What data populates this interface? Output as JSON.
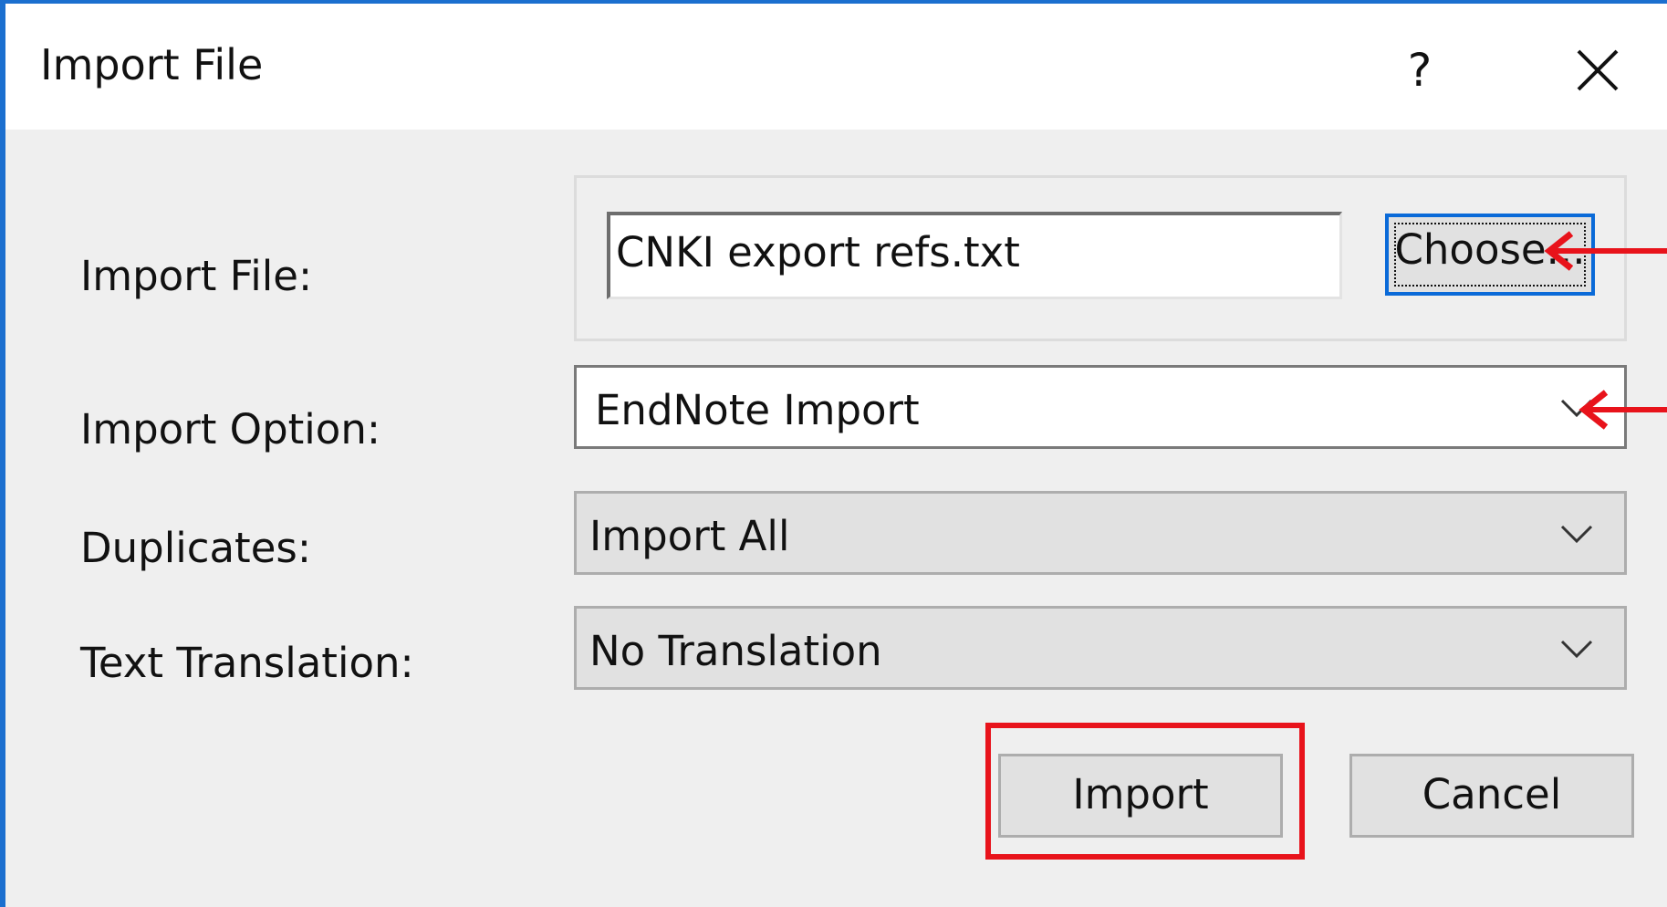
{
  "window": {
    "title": "Import File",
    "help_label": "?",
    "close_icon": "close-icon"
  },
  "form": {
    "import_file_label": "Import File:",
    "import_file_value": "CNKI export refs.txt",
    "choose_label": "Choose...",
    "import_option_label": "Import Option:",
    "import_option_value": "EndNote Import",
    "duplicates_label": "Duplicates:",
    "duplicates_value": "Import All",
    "text_translation_label": "Text Translation:",
    "text_translation_value": "No Translation"
  },
  "buttons": {
    "import_label": "Import",
    "cancel_label": "Cancel"
  },
  "annotations": {
    "arrow_color": "#e8131b",
    "highlight_color": "#e8131b"
  }
}
